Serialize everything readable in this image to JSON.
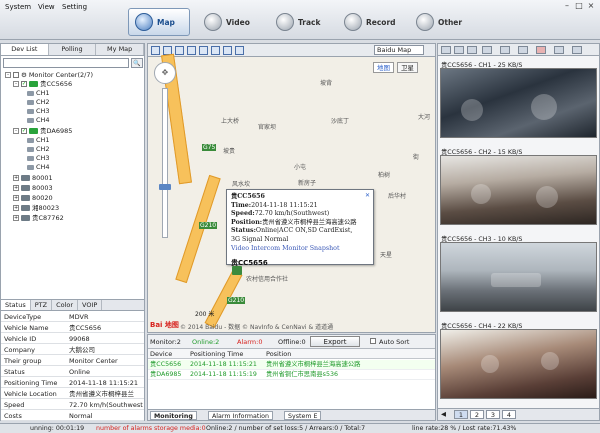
{
  "menu": {
    "system": "System",
    "view": "View",
    "setting": "Setting"
  },
  "nav": [
    {
      "label": "Map",
      "active": true
    },
    {
      "label": "Video"
    },
    {
      "label": "Track"
    },
    {
      "label": "Record"
    },
    {
      "label": "Other"
    }
  ],
  "left": {
    "tabs": [
      "Dev List",
      "Polling",
      "My Map"
    ],
    "tree": {
      "root": "Monitor Center(2/7)",
      "vehicles": [
        {
          "name": "贵CC5656",
          "channels": [
            "CH1",
            "CH2",
            "CH3",
            "CH4"
          ]
        },
        {
          "name": "贵DA6985",
          "channels": [
            "CH1",
            "CH2",
            "CH3",
            "CH4"
          ]
        }
      ],
      "others": [
        "80001",
        "80003",
        "80020",
        "湘80023",
        "贵C87762"
      ]
    },
    "props_tabs": [
      "Status",
      "PTZ",
      "Color",
      "VOIP"
    ],
    "props": [
      {
        "k": "DeviceType",
        "v": "MDVR"
      },
      {
        "k": "Vehicle Name",
        "v": "贵CC5656"
      },
      {
        "k": "Vehicle ID",
        "v": "99068"
      },
      {
        "k": "Company",
        "v": "大鹅公司"
      },
      {
        "k": "Their group",
        "v": "Monitor Center"
      },
      {
        "k": "Status",
        "v": "Online"
      },
      {
        "k": "Positioning Time",
        "v": "2014-11-18 11:15:21"
      },
      {
        "k": "Vehicle Location",
        "v": "贵州省遵义市桐梓县兰"
      },
      {
        "k": "Speed",
        "v": "72.70 km/h(Southwest)"
      },
      {
        "k": "Costs",
        "v": "Normal"
      }
    ]
  },
  "map": {
    "source": "Baidu Map",
    "type_map": "地图",
    "type_sat": "卫星",
    "labels": [
      "坡背",
      "上大桥",
      "官家坝",
      "沙底丁",
      "大河",
      "坡贵",
      "小屯",
      "街",
      "柏树",
      "新房子",
      "后华村",
      "风水坎",
      "天星",
      "G75",
      "G210",
      "G210",
      "农村信用合作社"
    ],
    "popup": {
      "title": "贵CC5656",
      "time_label": "Time:",
      "time": "2014-11-18 11:15:21",
      "speed_label": "Speed:",
      "speed": "72.70 km/h(Southwest)",
      "pos_label": "Position:",
      "pos": "贵州省遵义市桐梓县兰海高速公路",
      "status_label": "Status:",
      "status": "Online|ACC ON,SD CardExist,",
      "signal": "3G Signal Normal",
      "links": "Video  Intercom  Monitor  Snapshot"
    },
    "car_label": "贵CC5656",
    "scale": "200 米",
    "logo": "Bai 地图",
    "copyright": "© 2014 Baidu - 数据 © NavInfo & CenNavi & 道道通"
  },
  "monitor": {
    "monitor": "Monitor:2",
    "online": "Online:2",
    "alarm": "Alarm:0",
    "offline": "Offline:0",
    "export": "Export",
    "autosort": "Auto Sort",
    "columns": [
      "Device",
      "Positioning Time",
      "Position"
    ],
    "rows": [
      {
        "device": "贵CC5656",
        "time": "2014-11-18 11:15:21",
        "pos": "贵州省遵义市桐梓县兰海高速公路"
      },
      {
        "device": "贵DA6985",
        "time": "2014-11-18 11:15:19",
        "pos": "贵州省铜仁市思南县s536"
      }
    ],
    "tabs": [
      "Monitoring",
      "Alarm Information",
      "System E"
    ]
  },
  "video": {
    "channels": [
      {
        "title": "贵CC5656 - CH1 - 25 KB/S"
      },
      {
        "title": "贵CC5656 - CH2 - 15 KB/S"
      },
      {
        "title": "贵CC5656 - CH3 - 10 KB/S"
      },
      {
        "title": "贵CC5656 - CH4 - 22 KB/S"
      }
    ],
    "pages": [
      "1",
      "2",
      "3",
      "4"
    ]
  },
  "status": {
    "running": "unning: 00:01:19",
    "alarm_media": "number of alarms storage media:0",
    "online": "Online:2 / number of set loss:5 / Arrears:0 / Total:7",
    "loss_rate": "line rate:28 %  / Lost rate:71.43%"
  },
  "colors": {
    "accent": "#3366cc",
    "online": "#1f9a2a",
    "alarm": "#d7231f"
  }
}
